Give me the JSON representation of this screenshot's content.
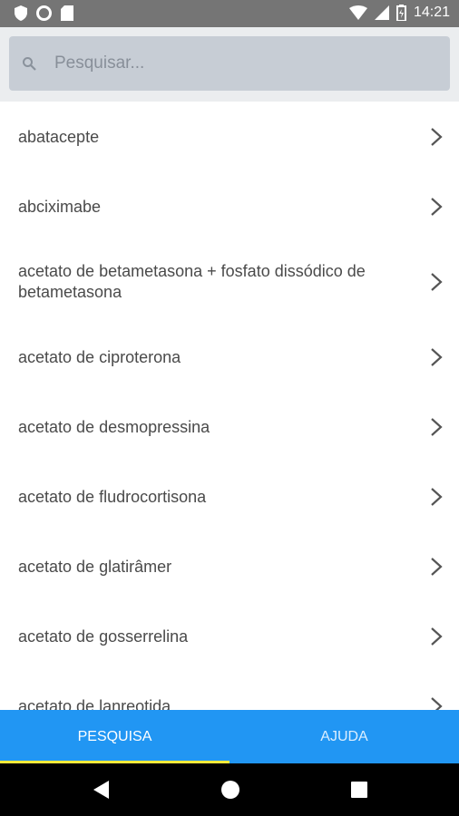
{
  "status_bar": {
    "time": "14:21",
    "left_icons": [
      "shield-icon",
      "circle-icon",
      "sd-card-icon"
    ],
    "right_icons": [
      "wifi-icon",
      "signal-icon",
      "battery-icon"
    ]
  },
  "search": {
    "placeholder": "Pesquisar...",
    "value": ""
  },
  "list": {
    "items": [
      {
        "label": "abatacepte"
      },
      {
        "label": "abciximabe"
      },
      {
        "label": "acetato de betametasona + fosfato dissódico de betametasona"
      },
      {
        "label": "acetato de ciproterona"
      },
      {
        "label": "acetato de desmopressina"
      },
      {
        "label": "acetato de fludrocortisona"
      },
      {
        "label": "acetato de glatirâmer"
      },
      {
        "label": "acetato de gosserrelina"
      },
      {
        "label": "acetato de lanreotida"
      }
    ]
  },
  "tabs": [
    {
      "label": "PESQUISA",
      "active": true
    },
    {
      "label": "AJUDA",
      "active": false
    }
  ],
  "colors": {
    "status_bar": "#757575",
    "search_bg": "#ebedef",
    "search_box": "#c7cdd5",
    "tab_bar": "#2196f3",
    "tab_indicator": "#ffeb3b",
    "nav_bar": "#000000"
  }
}
